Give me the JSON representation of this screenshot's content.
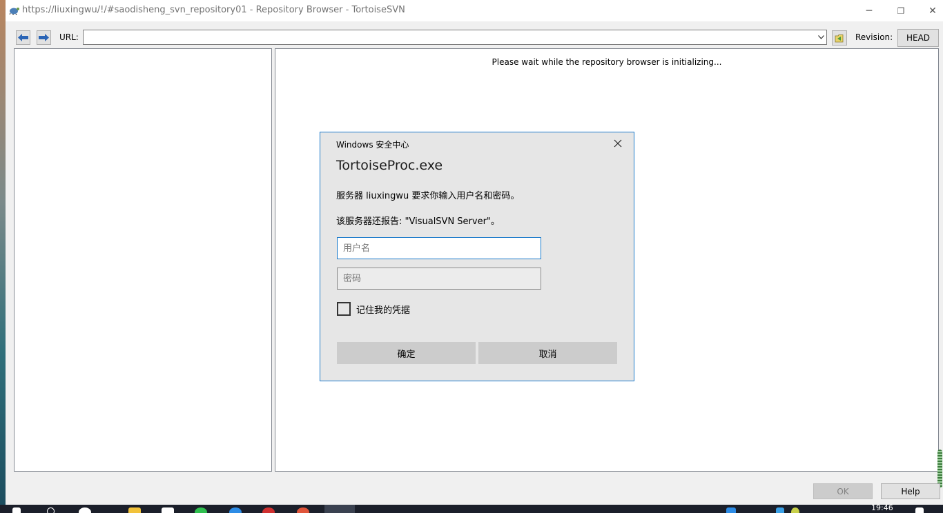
{
  "window": {
    "title": "https://liuxingwu/!/#saodisheng_svn_repository01 - Repository Browser - TortoiseSVN",
    "minimize_glyph": "─",
    "restore_glyph": "❐",
    "close_glyph": "✕"
  },
  "toolbar": {
    "url_label": "URL:",
    "url_value": "",
    "revision_label": "Revision:",
    "revision_button": "HEAD"
  },
  "panes": {
    "init_message": "Please wait while the repository browser is initializing..."
  },
  "footer": {
    "ok_label": "OK",
    "help_label": "Help"
  },
  "dialog": {
    "caption": "Windows 安全中心",
    "app_name": "TortoiseProc.exe",
    "message1": "服务器 liuxingwu 要求你输入用户名和密码。",
    "message2": "该服务器还报告: \"VisualSVN Server\"。",
    "username_placeholder": "用户名",
    "password_placeholder": "密码",
    "remember_label": "记住我的凭据",
    "remember_checked": false,
    "confirm_label": "确定",
    "cancel_label": "取消"
  },
  "taskbar": {
    "clock": "19:46"
  },
  "colors": {
    "accent": "#1979ca",
    "nav_arrow": "#2a64b5",
    "dialog_bg": "#e6e6e6"
  }
}
